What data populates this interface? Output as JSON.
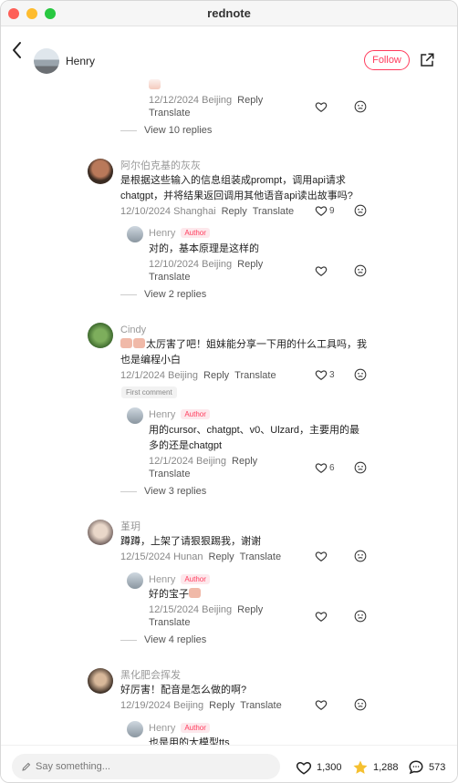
{
  "window": {
    "title": "rednote"
  },
  "header": {
    "user": "Henry",
    "follow": "Follow"
  },
  "top": {
    "emoji": "",
    "date": "12/12/2024 Beijing",
    "reply": "Reply",
    "translate": "Translate",
    "view_replies": "View 10 replies"
  },
  "c1": {
    "name": "阿尔伯克基的灰灰",
    "text1": "是根据这些输入的信息组装成prompt，调用api请求",
    "text2": "chatgpt，并将结果返回调用其他语音api读出故事吗?",
    "date": "12/10/2024 Shanghai",
    "reply": "Reply",
    "translate": "Translate",
    "likes": "9"
  },
  "r1": {
    "name": "Henry",
    "badge": "Author",
    "text": "对的，基本原理是这样的",
    "date": "12/10/2024 Beijing",
    "reply": "Reply",
    "translate": "Translate",
    "view_replies": "View 2 replies"
  },
  "c2": {
    "name": "Cindy",
    "text1": "太厉害了吧！姐妹能分享一下用的什么工具吗，我",
    "text2": "也是编程小白",
    "date": "12/1/2024 Beijing",
    "reply": "Reply",
    "translate": "Translate",
    "likes": "3",
    "first": "First comment"
  },
  "r2": {
    "name": "Henry",
    "badge": "Author",
    "text1": "用的cursor、chatgpt、v0、Ulzard，主要用的最",
    "text2": "多的还是chatgpt",
    "date": "12/1/2024 Beijing",
    "reply": "Reply",
    "translate": "Translate",
    "likes": "6",
    "view_replies": "View 3 replies"
  },
  "c3": {
    "name": "堇玥",
    "text": "蹲蹲，上架了请狠狠踢我，谢谢",
    "date": "12/15/2024 Hunan",
    "reply": "Reply",
    "translate": "Translate"
  },
  "r3": {
    "name": "Henry",
    "badge": "Author",
    "text": "好的宝子",
    "date": "12/15/2024 Beijing",
    "reply": "Reply",
    "translate": "Translate",
    "view_replies": "View 4 replies"
  },
  "c4": {
    "name": "黑化肥会挥发",
    "text": "好厉害！配音是怎么做的啊?",
    "date": "12/19/2024 Beijing",
    "reply": "Reply",
    "translate": "Translate"
  },
  "r4": {
    "name": "Henry",
    "badge": "Author",
    "text": "也是用的大模型tts"
  },
  "bottom": {
    "placeholder": "Say something...",
    "likes": "1,300",
    "stars": "1,288",
    "comments": "573"
  },
  "colors": {
    "accent": "#ff3b5c",
    "star": "#f5c030"
  },
  "icons": [
    "back-chevron-icon",
    "share-icon",
    "heart-icon",
    "dislike-icon",
    "pencil-icon",
    "star-icon",
    "comment-bubble-icon"
  ]
}
